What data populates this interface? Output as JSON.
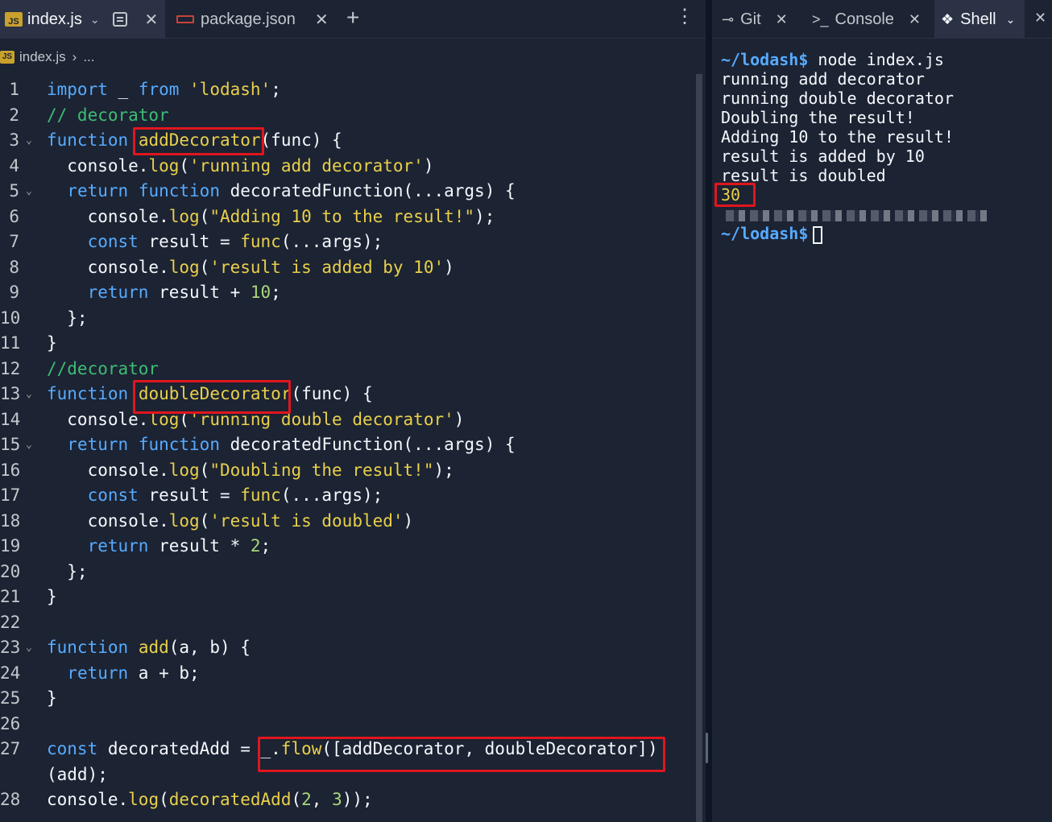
{
  "editor": {
    "tabs": [
      {
        "label": "index.js",
        "icon": "js-file-icon"
      },
      {
        "label": "package.json",
        "icon": "json-file-icon"
      }
    ],
    "js_badge": "JS",
    "breadcrumb": {
      "file": "index.js",
      "separator": "›",
      "rest": "..."
    },
    "lines": [
      {
        "n": "1",
        "fold": false,
        "tokens": [
          [
            "kw",
            "import"
          ],
          [
            "op",
            " _ "
          ],
          [
            "kw",
            "from"
          ],
          [
            "op",
            " "
          ],
          [
            "str",
            "'lodash'"
          ],
          [
            "op",
            ";"
          ]
        ]
      },
      {
        "n": "2",
        "fold": false,
        "tokens": [
          [
            "cm",
            "// decorator"
          ]
        ]
      },
      {
        "n": "3",
        "fold": true,
        "tokens": [
          [
            "kw",
            "function"
          ],
          [
            "op",
            " "
          ],
          [
            "fn",
            "addDecorator"
          ],
          [
            "op",
            "(func) {"
          ]
        ]
      },
      {
        "n": "4",
        "fold": false,
        "tokens": [
          [
            "op",
            "  console."
          ],
          [
            "fn",
            "log"
          ],
          [
            "op",
            "("
          ],
          [
            "str",
            "'running add decorator'"
          ],
          [
            "op",
            ")"
          ]
        ]
      },
      {
        "n": "5",
        "fold": true,
        "tokens": [
          [
            "op",
            "  "
          ],
          [
            "kw",
            "return"
          ],
          [
            "op",
            " "
          ],
          [
            "kw",
            "function"
          ],
          [
            "op",
            " decoratedFunction(...args) {"
          ]
        ]
      },
      {
        "n": "6",
        "fold": false,
        "tokens": [
          [
            "op",
            "    console."
          ],
          [
            "fn",
            "log"
          ],
          [
            "op",
            "("
          ],
          [
            "str",
            "\"Adding 10 to the result!\""
          ],
          [
            "op",
            ");"
          ]
        ]
      },
      {
        "n": "7",
        "fold": false,
        "tokens": [
          [
            "op",
            "    "
          ],
          [
            "kw",
            "const"
          ],
          [
            "op",
            " result = "
          ],
          [
            "fn",
            "func"
          ],
          [
            "op",
            "(...args);"
          ]
        ]
      },
      {
        "n": "8",
        "fold": false,
        "tokens": [
          [
            "op",
            "    console."
          ],
          [
            "fn",
            "log"
          ],
          [
            "op",
            "("
          ],
          [
            "str",
            "'result is added by 10'"
          ],
          [
            "op",
            ")"
          ]
        ]
      },
      {
        "n": "9",
        "fold": false,
        "tokens": [
          [
            "op",
            "    "
          ],
          [
            "kw",
            "return"
          ],
          [
            "op",
            " result + "
          ],
          [
            "num",
            "10"
          ],
          [
            "op",
            ";"
          ]
        ]
      },
      {
        "n": "10",
        "fold": false,
        "tokens": [
          [
            "op",
            "  };"
          ]
        ]
      },
      {
        "n": "11",
        "fold": false,
        "tokens": [
          [
            "op",
            "}"
          ]
        ]
      },
      {
        "n": "12",
        "fold": false,
        "tokens": [
          [
            "cm",
            "//decorator"
          ]
        ]
      },
      {
        "n": "13",
        "fold": true,
        "tokens": [
          [
            "kw",
            "function"
          ],
          [
            "op",
            " "
          ],
          [
            "fn",
            "doubleDecorator"
          ],
          [
            "op",
            "(func) {"
          ]
        ]
      },
      {
        "n": "14",
        "fold": false,
        "tokens": [
          [
            "op",
            "  console."
          ],
          [
            "fn",
            "log"
          ],
          [
            "op",
            "("
          ],
          [
            "str",
            "'running double decorator'"
          ],
          [
            "op",
            ")"
          ]
        ]
      },
      {
        "n": "15",
        "fold": true,
        "tokens": [
          [
            "op",
            "  "
          ],
          [
            "kw",
            "return"
          ],
          [
            "op",
            " "
          ],
          [
            "kw",
            "function"
          ],
          [
            "op",
            " decoratedFunction(...args) {"
          ]
        ]
      },
      {
        "n": "16",
        "fold": false,
        "tokens": [
          [
            "op",
            "    console."
          ],
          [
            "fn",
            "log"
          ],
          [
            "op",
            "("
          ],
          [
            "str",
            "\"Doubling the result!\""
          ],
          [
            "op",
            ");"
          ]
        ]
      },
      {
        "n": "17",
        "fold": false,
        "tokens": [
          [
            "op",
            "    "
          ],
          [
            "kw",
            "const"
          ],
          [
            "op",
            " result = "
          ],
          [
            "fn",
            "func"
          ],
          [
            "op",
            "(...args);"
          ]
        ]
      },
      {
        "n": "18",
        "fold": false,
        "tokens": [
          [
            "op",
            "    console."
          ],
          [
            "fn",
            "log"
          ],
          [
            "op",
            "("
          ],
          [
            "str",
            "'result is doubled'"
          ],
          [
            "op",
            ")"
          ]
        ]
      },
      {
        "n": "19",
        "fold": false,
        "tokens": [
          [
            "op",
            "    "
          ],
          [
            "kw",
            "return"
          ],
          [
            "op",
            " result * "
          ],
          [
            "num",
            "2"
          ],
          [
            "op",
            ";"
          ]
        ]
      },
      {
        "n": "20",
        "fold": false,
        "tokens": [
          [
            "op",
            "  };"
          ]
        ]
      },
      {
        "n": "21",
        "fold": false,
        "tokens": [
          [
            "op",
            "}"
          ]
        ]
      },
      {
        "n": "22",
        "fold": false,
        "tokens": []
      },
      {
        "n": "23",
        "fold": true,
        "tokens": [
          [
            "kw",
            "function"
          ],
          [
            "op",
            " "
          ],
          [
            "fn",
            "add"
          ],
          [
            "op",
            "(a, b) {"
          ]
        ]
      },
      {
        "n": "24",
        "fold": false,
        "tokens": [
          [
            "op",
            "  "
          ],
          [
            "kw",
            "return"
          ],
          [
            "op",
            " a + b;"
          ]
        ]
      },
      {
        "n": "25",
        "fold": false,
        "tokens": [
          [
            "op",
            "}"
          ]
        ]
      },
      {
        "n": "26",
        "fold": false,
        "tokens": []
      },
      {
        "n": "27",
        "fold": false,
        "tokens": [
          [
            "kw",
            "const"
          ],
          [
            "op",
            " decoratedAdd = _."
          ],
          [
            "fn",
            "flow"
          ],
          [
            "op",
            "([addDecorator, doubleDecorator])"
          ]
        ]
      },
      {
        "n": "",
        "fold": false,
        "tokens": [
          [
            "op",
            "(add);"
          ]
        ]
      },
      {
        "n": "28",
        "fold": false,
        "tokens": [
          [
            "op",
            "console."
          ],
          [
            "fn",
            "log"
          ],
          [
            "op",
            "("
          ],
          [
            "fn",
            "decoratedAdd"
          ],
          [
            "op",
            "("
          ],
          [
            "num",
            "2"
          ],
          [
            "op",
            ", "
          ],
          [
            "num",
            "3"
          ],
          [
            "op",
            "));"
          ]
        ]
      }
    ]
  },
  "terminal": {
    "tabs": [
      {
        "label": "Git",
        "icon": "git-branch-icon"
      },
      {
        "label": "Console",
        "icon": "console-prompt-icon"
      },
      {
        "label": "Shell",
        "icon": "shell-icon"
      }
    ],
    "prompt": "~/lodash$",
    "command": "node index.js",
    "output": [
      "running add decorator",
      "running double decorator",
      "Doubling the result!",
      "Adding 10 to the result!",
      "result is added by 10",
      "result is doubled"
    ],
    "result": "30"
  },
  "colors": {
    "background": "#1c2333",
    "keyword": "#57abff",
    "function": "#e9d04b",
    "comment": "#3dbd74",
    "number": "#a9d77b",
    "highlight_box": "#e0161e"
  }
}
